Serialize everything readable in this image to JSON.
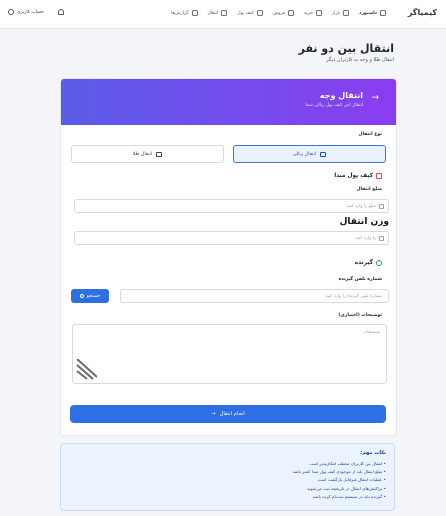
{
  "app": {
    "brand": "کیمیاگر"
  },
  "nav": [
    {
      "label": "داشبورد",
      "icon": "home-icon"
    },
    {
      "label": "بازار",
      "icon": "chart-icon"
    },
    {
      "label": "خرید",
      "icon": "cart-icon"
    },
    {
      "label": "فروش",
      "icon": "tag-icon"
    },
    {
      "label": "کیف پول",
      "icon": "wallet-icon"
    },
    {
      "label": "انتقال",
      "icon": "transfer-icon"
    },
    {
      "label": "گزارش‌ها",
      "icon": "report-icon"
    }
  ],
  "user": {
    "label": "حساب کاربری"
  },
  "page": {
    "title": "انتقال بین دو نفر",
    "subtitle": "انتقال طلا و وجه به کاربران دیگر"
  },
  "hero": {
    "title": "انتقال وجه",
    "subtitle": "انتقال امن کیف پول ریالی شما"
  },
  "form": {
    "type_label": "نوع انتقال",
    "type_rial": "انتقال ریالی",
    "type_gold": "انتقال طلا",
    "source_wallet": "کیف پول مبدا",
    "amount_label": "مبلغ انتقال",
    "amount_placeholder": "مبلغ را وارد کنید",
    "weight_title": "وزن انتقال",
    "weight_placeholder": "را وارد کنید",
    "recipient_title": "گیرنده",
    "phone_label": "شماره تلفن گیرنده",
    "phone_placeholder": "شماره تلفن گیرنده را وارد کنید",
    "search_label": "جستجو",
    "desc_label": "توضیحات (اختیاری)",
    "desc_placeholder": "توضیحات",
    "submit_label": "انجام انتقال"
  },
  "notes": {
    "title": "نکات مهم:",
    "items": [
      "• انتقال بین کاربران مختلف امکان‌پذیر است",
      "• مبلغ انتقال باید از موجودی کیف پول مبدا کمتر باشد",
      "• عملیات انتقال غیرقابل بازگشت است",
      "• تراکنش‌های انتقال در تاریخچه ثبت می‌شوند",
      "• گیرنده باید در سیستم ثبت‌نام کرده باشد"
    ]
  },
  "colors": {
    "accent": "#2f6fe4",
    "hero_start": "#5b5ce8",
    "hero_end": "#8a3df0"
  }
}
